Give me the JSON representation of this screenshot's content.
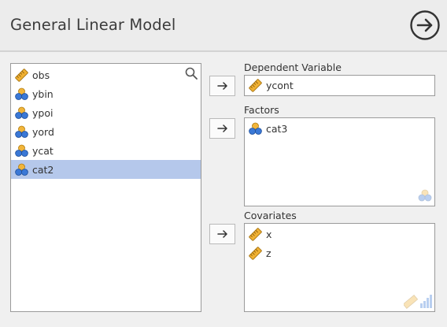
{
  "header": {
    "title": "General Linear Model",
    "nav_icon": "arrow-right-circle-icon"
  },
  "variables": [
    {
      "name": "obs",
      "type": "continuous",
      "selected": false
    },
    {
      "name": "ybin",
      "type": "nominal",
      "selected": false
    },
    {
      "name": "ypoi",
      "type": "nominal",
      "selected": false
    },
    {
      "name": "yord",
      "type": "nominal",
      "selected": false
    },
    {
      "name": "ycat",
      "type": "nominal",
      "selected": false
    },
    {
      "name": "cat2",
      "type": "nominal",
      "selected": true
    }
  ],
  "dependent": {
    "label": "Dependent Variable",
    "items": [
      "ycont"
    ]
  },
  "factors": {
    "label": "Factors",
    "items": [
      "cat3"
    ]
  },
  "covariates": {
    "label": "Covariates",
    "items": [
      "x",
      "z"
    ]
  },
  "colors": {
    "selection": "#b5c8eb",
    "ruler": "#f0b133",
    "nominal_top": "#f2b53a",
    "nominal_bottom": "#3a78d6",
    "header_border": "#d3d3d3"
  }
}
